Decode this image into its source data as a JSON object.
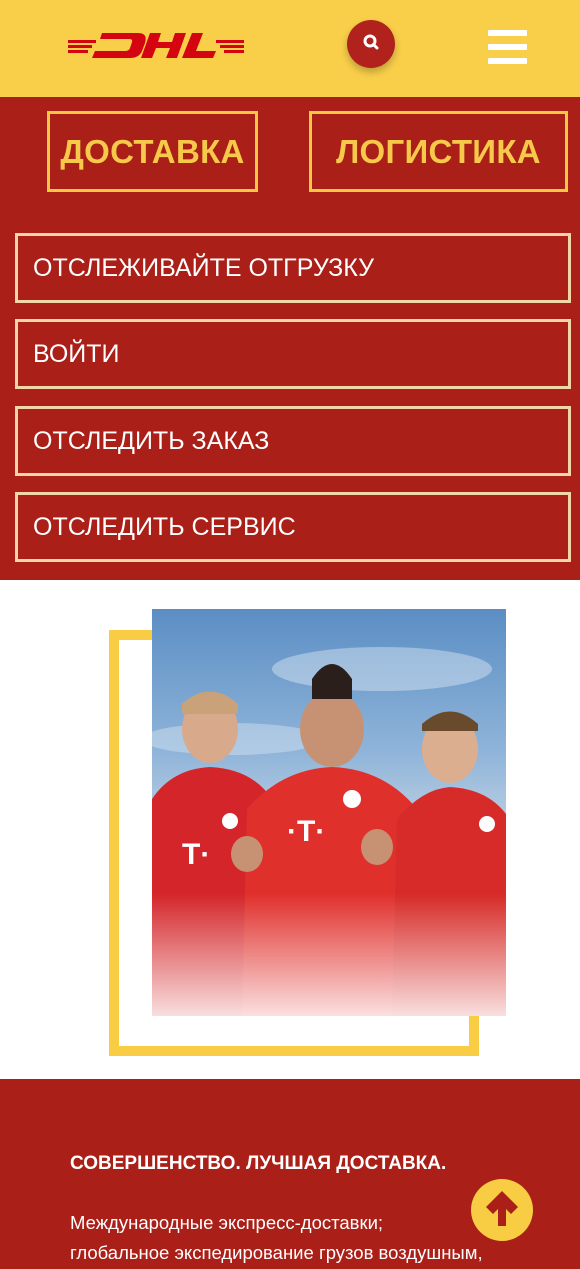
{
  "header": {
    "logo_text": "DHL",
    "search_icon": "search-icon",
    "menu_icon": "hamburger-menu-icon"
  },
  "nav": {
    "categories": [
      {
        "label": "ДОСТАВКА"
      },
      {
        "label": "ЛОГИСТИКА"
      }
    ],
    "items": [
      {
        "label": "ОТСЛЕЖИВАЙТЕ ОТГРУЗКУ"
      },
      {
        "label": "ВОЙТИ"
      },
      {
        "label": "ОТСЛЕДИТЬ ЗАКАЗ"
      },
      {
        "label": "ОТСЛЕДИТЬ СЕРВИС"
      }
    ]
  },
  "promo": {
    "image": "football-players-photo"
  },
  "content": {
    "headline": "СОВЕРШЕНСТВО. ЛУЧШАЯ ДОСТАВКА.",
    "body_lines": [
      "Международные экспресс-доставки;",
      "глобальное экспедирование грузов воздушным,"
    ]
  },
  "colors": {
    "brand_yellow": "#f9cf4a",
    "brand_red": "#aa1f17",
    "button_red": "#b0221b"
  },
  "scroll_top_icon": "arrow-up-icon"
}
